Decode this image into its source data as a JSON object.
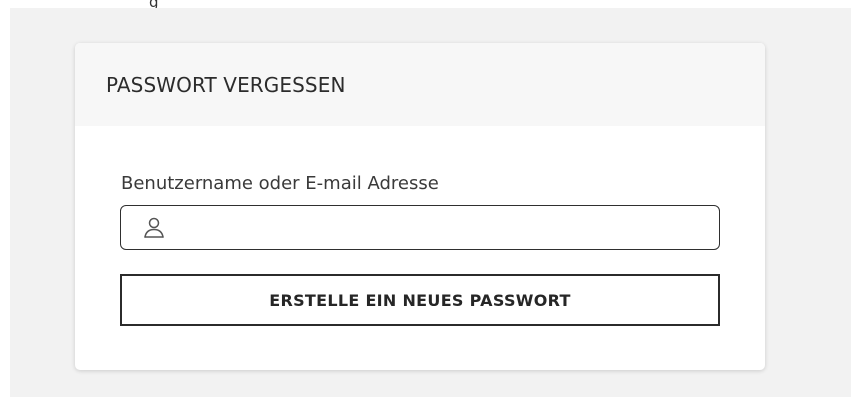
{
  "top_fragment": "g",
  "card": {
    "title": "PASSWORT VERGESSEN",
    "field_label": "Benutzername oder E-mail Adresse",
    "input_value": "",
    "input_icon": "user-icon",
    "button_label": "ERSTELLE EIN NEUES PASSWORT"
  },
  "colors": {
    "page_background": "#f2f2f2",
    "card_header_background": "#f7f7f7",
    "card_background": "#ffffff",
    "border": "#2b2b2b"
  }
}
